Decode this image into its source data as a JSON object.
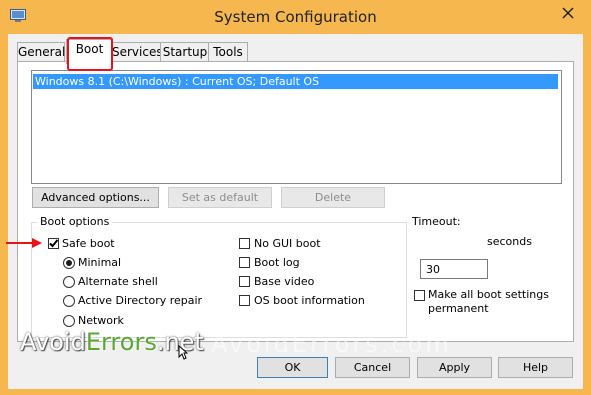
{
  "window": {
    "title": "System Configuration"
  },
  "tabs": [
    {
      "label": "General"
    },
    {
      "label": "Boot"
    },
    {
      "label": "Services"
    },
    {
      "label": "Startup"
    },
    {
      "label": "Tools"
    }
  ],
  "os_list": {
    "items": [
      "Windows 8.1 (C:\\Windows) : Current OS; Default OS"
    ]
  },
  "buttons": {
    "advanced_options": "Advanced options...",
    "set_as_default": "Set as default",
    "delete": "Delete",
    "ok": "OK",
    "cancel": "Cancel",
    "apply": "Apply",
    "help": "Help"
  },
  "boot_options": {
    "label": "Boot options",
    "safe_boot": {
      "label": "Safe boot",
      "checked": true
    },
    "radios": [
      {
        "label": "Minimal",
        "selected": true
      },
      {
        "label": "Alternate shell",
        "selected": false
      },
      {
        "label": "Active Directory repair",
        "selected": false
      },
      {
        "label": "Network",
        "selected": false
      }
    ],
    "right_checks": [
      {
        "label": "No GUI boot",
        "checked": false
      },
      {
        "label": "Boot log",
        "checked": false
      },
      {
        "label": "Base video",
        "checked": false
      },
      {
        "label": "OS boot information",
        "checked": false
      }
    ]
  },
  "timeout": {
    "label": "Timeout:",
    "value": "30",
    "unit": "seconds"
  },
  "make_permanent": {
    "label_line1": "Make all boot settings",
    "label_line2": "permanent",
    "checked": false
  },
  "watermark": {
    "part1": "Avoid",
    "part2": "Errors",
    "part3": ".net",
    "ghost": "AvoidErrors.com"
  },
  "colors": {
    "accent_border": "#e8131a",
    "selection": "#3399ff",
    "arrow": "#e8131a",
    "watermark_green": "#5aa832",
    "title_bar": "#f6b84e"
  }
}
